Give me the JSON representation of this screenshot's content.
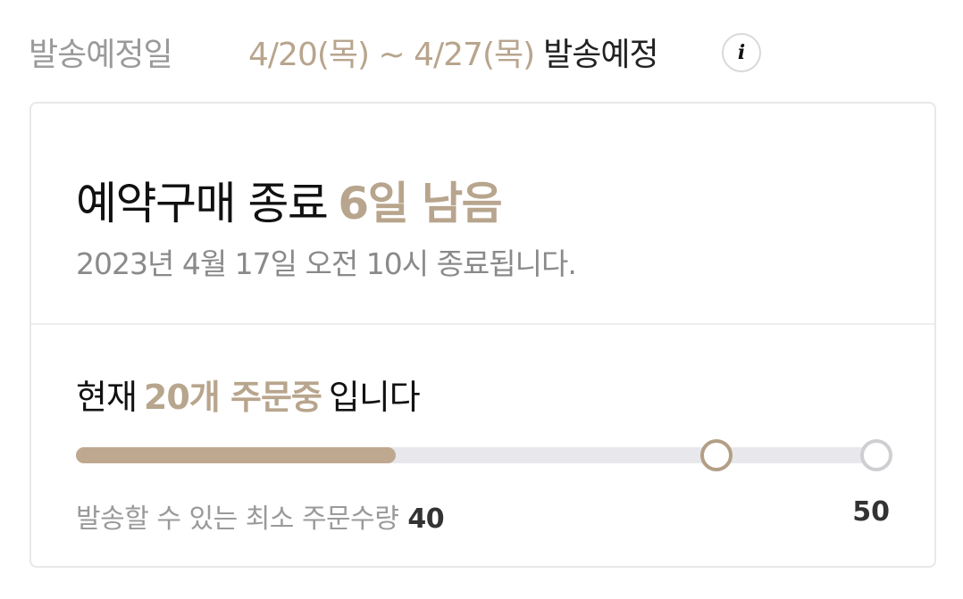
{
  "shipping": {
    "label": "발송예정일",
    "date_range": "4/20(목) ~ 4/27(목)",
    "suffix": "발송예정",
    "info_icon": "info-icon"
  },
  "deadline": {
    "title": "예약구매 종료",
    "remaining": "6일 남음",
    "subtitle": "2023년 4월 17일 오전 10시 종료됩니다."
  },
  "orders": {
    "prefix": "현재",
    "current_count": "20개 주문중",
    "suffix": "입니다",
    "current": 20,
    "min_label": "발송할 수 있는 최소 주문수량",
    "min": 40,
    "max": 50,
    "min_display": "40",
    "max_display": "50"
  },
  "colors": {
    "accent": "#b8a58d",
    "fill": "#bfa890",
    "track": "#e8e8ec"
  }
}
